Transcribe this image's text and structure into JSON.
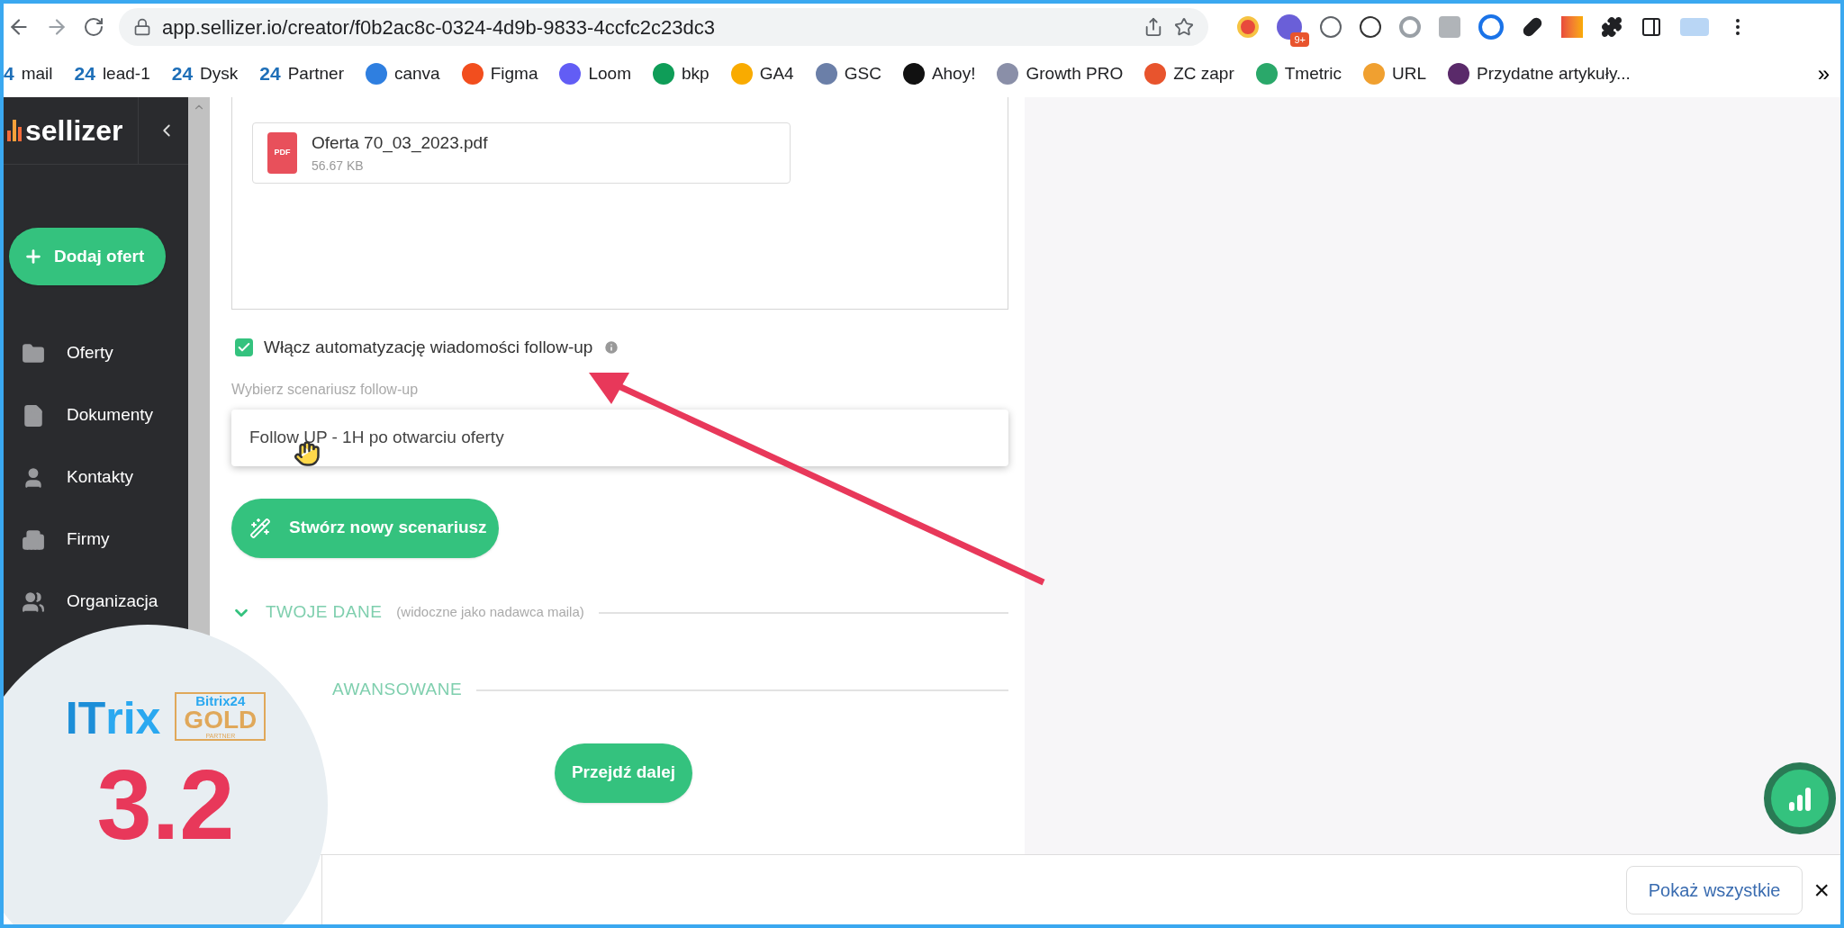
{
  "browser": {
    "url": "app.sellizer.io/creator/f0b2ac8c-0324-4d9b-9833-4ccfc2c23dc3",
    "extension_badge": "9+",
    "more": "»",
    "bookmarks": [
      {
        "label": "mail",
        "glyph": "4",
        "color": "#1e6fb8"
      },
      {
        "label": "lead-1",
        "glyph": "24",
        "color": "#1e6fb8"
      },
      {
        "label": "Dysk",
        "glyph": "24",
        "color": "#1e6fb8"
      },
      {
        "label": "Partner",
        "glyph": "24",
        "color": "#1e6fb8"
      },
      {
        "label": "canva",
        "color": "#2f7fe0"
      },
      {
        "label": "Figma",
        "color": "#f24e1e"
      },
      {
        "label": "Loom",
        "color": "#625df5"
      },
      {
        "label": "bkp",
        "color": "#0f9d58"
      },
      {
        "label": "GA4",
        "color": "#f9ab00"
      },
      {
        "label": "GSC",
        "color": "#6b7fa8"
      },
      {
        "label": "Ahoy!",
        "color": "#111111"
      },
      {
        "label": "Growth PRO",
        "color": "#8a8fa8"
      },
      {
        "label": "ZC zapr",
        "color": "#e8542d"
      },
      {
        "label": "Tmetric",
        "color": "#2aa86a"
      },
      {
        "label": "URL",
        "color": "#f0a030"
      },
      {
        "label": "Przydatne artykuły...",
        "color": "#5a2a6a"
      }
    ]
  },
  "sidebar": {
    "logo": "sellizer",
    "add_button": "Dodaj ofert",
    "items": [
      "Oferty",
      "Dokumenty",
      "Kontakty",
      "Firmy",
      "Organizacja"
    ]
  },
  "file": {
    "name": "Oferta 70_03_2023.pdf",
    "size": "56.67 KB",
    "badge": "PDF"
  },
  "followup": {
    "checked": true,
    "label": "Włącz automatyzację wiadomości follow-up",
    "select_label": "Wybierz scenariusz follow-up",
    "option": "Follow UP - 1H po otwarciu oferty"
  },
  "new_scenario_button": "Stwórz nowy scenariusz",
  "sections": [
    {
      "title": "TWOJE DANE",
      "note": "(widoczne jako nadawca maila)",
      "expanded": true
    },
    {
      "title": "AWANSOWANE"
    }
  ],
  "next_button": "Przejdź dalej",
  "downloads": {
    "show_all": "Pokaż wszystkie",
    "close": "×"
  },
  "overlay": {
    "logo_left": "IT",
    "logo_right": "rix",
    "partner_brand": "Bitrix24",
    "partner_level": "GOLD",
    "partner_label": "PARTNER",
    "step": "3.2"
  }
}
